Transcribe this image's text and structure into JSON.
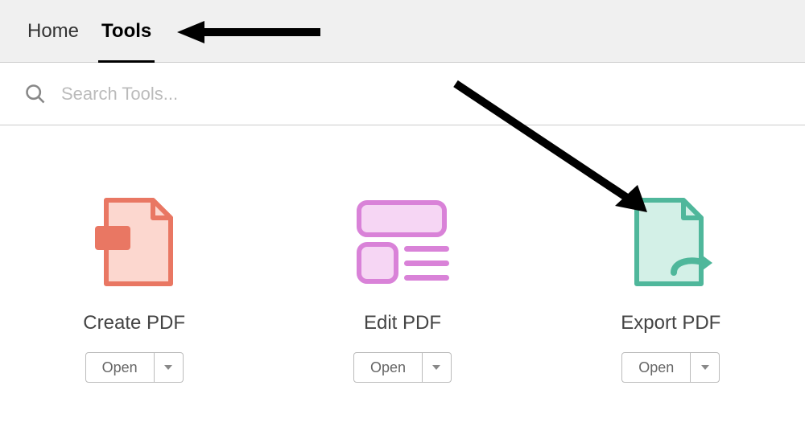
{
  "tabs": {
    "home": "Home",
    "tools": "Tools"
  },
  "search": {
    "placeholder": "Search Tools..."
  },
  "tools_grid": {
    "create_pdf": {
      "label": "Create PDF",
      "button": "Open"
    },
    "edit_pdf": {
      "label": "Edit PDF",
      "button": "Open"
    },
    "export_pdf": {
      "label": "Export PDF",
      "button": "Open"
    }
  }
}
